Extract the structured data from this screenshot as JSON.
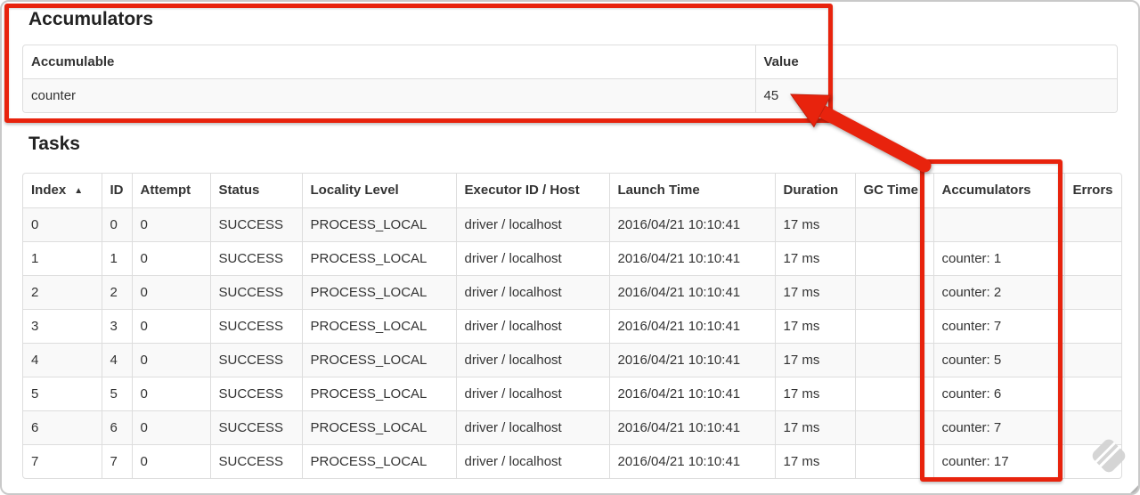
{
  "colors": {
    "annotation_red": "#e8230d",
    "table_border": "#dddddd",
    "row_stripe": "#f9f9f9"
  },
  "accumulators_section": {
    "title": "Accumulators",
    "columns": [
      "Accumulable",
      "Value"
    ],
    "rows": [
      [
        "counter",
        "45"
      ]
    ]
  },
  "tasks_section": {
    "title": "Tasks",
    "columns": [
      "Index",
      "ID",
      "Attempt",
      "Status",
      "Locality Level",
      "Executor ID / Host",
      "Launch Time",
      "Duration",
      "GC Time",
      "Accumulators",
      "Errors"
    ],
    "sort": {
      "column": "Index",
      "direction_icon": "▲"
    },
    "rows": [
      [
        "0",
        "0",
        "0",
        "SUCCESS",
        "PROCESS_LOCAL",
        "driver / localhost",
        "2016/04/21 10:10:41",
        "17 ms",
        "",
        "",
        ""
      ],
      [
        "1",
        "1",
        "0",
        "SUCCESS",
        "PROCESS_LOCAL",
        "driver / localhost",
        "2016/04/21 10:10:41",
        "17 ms",
        "",
        "counter: 1",
        ""
      ],
      [
        "2",
        "2",
        "0",
        "SUCCESS",
        "PROCESS_LOCAL",
        "driver / localhost",
        "2016/04/21 10:10:41",
        "17 ms",
        "",
        "counter: 2",
        ""
      ],
      [
        "3",
        "3",
        "0",
        "SUCCESS",
        "PROCESS_LOCAL",
        "driver / localhost",
        "2016/04/21 10:10:41",
        "17 ms",
        "",
        "counter: 7",
        ""
      ],
      [
        "4",
        "4",
        "0",
        "SUCCESS",
        "PROCESS_LOCAL",
        "driver / localhost",
        "2016/04/21 10:10:41",
        "17 ms",
        "",
        "counter: 5",
        ""
      ],
      [
        "5",
        "5",
        "0",
        "SUCCESS",
        "PROCESS_LOCAL",
        "driver / localhost",
        "2016/04/21 10:10:41",
        "17 ms",
        "",
        "counter: 6",
        ""
      ],
      [
        "6",
        "6",
        "0",
        "SUCCESS",
        "PROCESS_LOCAL",
        "driver / localhost",
        "2016/04/21 10:10:41",
        "17 ms",
        "",
        "counter: 7",
        ""
      ],
      [
        "7",
        "7",
        "0",
        "SUCCESS",
        "PROCESS_LOCAL",
        "driver / localhost",
        "2016/04/21 10:10:41",
        "17 ms",
        "",
        "counter: 17",
        ""
      ]
    ]
  }
}
